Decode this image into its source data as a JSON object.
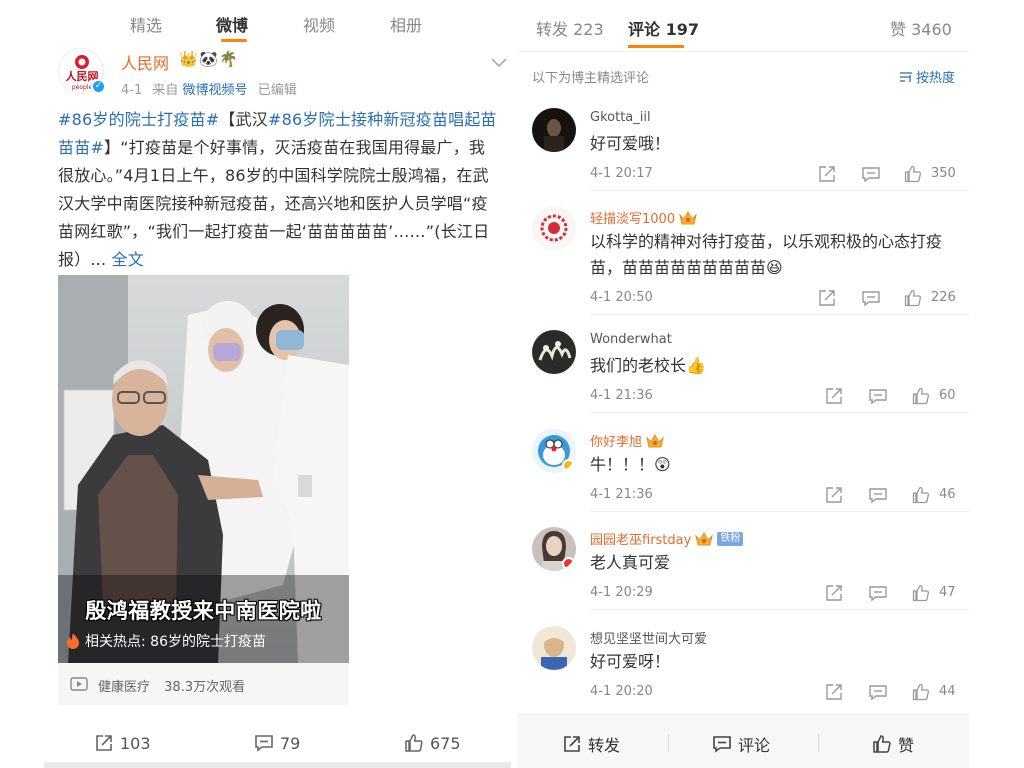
{
  "left_tabs": [
    "精选",
    "微博",
    "视频",
    "相册"
  ],
  "post": {
    "author": "人民网",
    "author_logo_text": "人民网",
    "author_logo_sub": "people",
    "badges": [
      "👑",
      "🐼",
      "🌴"
    ],
    "date": "4-1",
    "source_prefix": "来自",
    "source": "微博视频号",
    "edited": "已编辑",
    "text_parts": [
      {
        "t": "#86岁的院士打疫苗#",
        "k": "tag"
      },
      {
        "t": "【武汉",
        "k": "plain"
      },
      {
        "t": "#86岁院士接种新冠疫苗唱起苗苗苗#",
        "k": "tag"
      },
      {
        "t": "】“打疫苗是个好事情，灭活疫苗在我国用得最广，我很放心。”4月1日上午，86岁的中国科学院院士殷鸿福，在武汉大学中南医院接种新冠疫苗，还高兴地和医护人员学唱“疫苗网红歌”，“我们一起打疫苗一起‘苗苗苗苗苗’……”(长江日报）... ",
        "k": "plain"
      },
      {
        "t": "全文",
        "k": "more"
      }
    ],
    "video_caption": "殷鸿福教授来中南医院啦",
    "video_hot": "相关热点: 86岁的院士打疫苗",
    "video_category": "健康医疗",
    "video_views": "38.3万次观看",
    "reposts": "103",
    "comments": "79",
    "likes": "675"
  },
  "right_tabs": {
    "repost_label": "转发",
    "repost_count": "223",
    "comment_label": "评论",
    "comment_count": "197",
    "like_label": "赞",
    "like_count": "3460"
  },
  "hint": "以下为博主精选评论",
  "sort_label": "按热度",
  "comments": [
    {
      "name": "Gkotta_iil",
      "text": "好可爱哦！",
      "time": "4-1 20:17",
      "likes": "350"
    },
    {
      "name": "轻描淡写1000",
      "text": "以科学的精神对待打疫苗，以乐观积极的心态打疫苗，苗苗苗苗苗苗苗苗苗😆",
      "time": "4-1 20:50",
      "likes": "226"
    },
    {
      "name": "Wonderwhat",
      "text": "我们的老校长👍",
      "time": "4-1 21:36",
      "likes": "60"
    },
    {
      "name": "你好李旭",
      "text": "牛！！！😲",
      "time": "4-1 21:36",
      "likes": "46"
    },
    {
      "name": "园园老巫firstday",
      "badge": "铁粉",
      "text": "老人真可爱",
      "time": "4-1 20:29",
      "likes": "47"
    },
    {
      "name": "想见坚坚世间大可爱",
      "text": "好可爱呀！",
      "time": "4-1 20:20",
      "likes": "44"
    }
  ],
  "bottom_bar": {
    "repost": "转发",
    "comment": "评论",
    "like": "赞"
  },
  "colors": {
    "accent": "#ff8200",
    "link": "#2a6fb4",
    "vip_name": "#e86a2e"
  }
}
